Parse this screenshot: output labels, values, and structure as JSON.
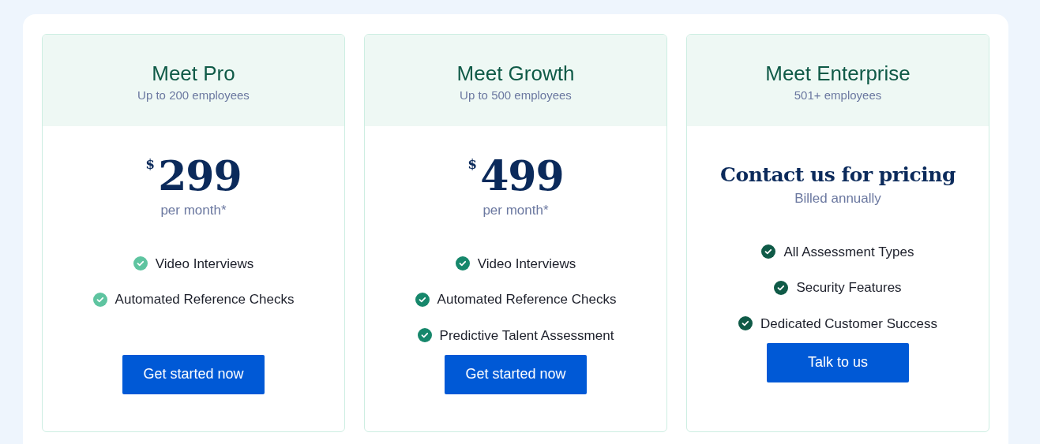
{
  "plans": [
    {
      "name": "Meet Pro",
      "audience": "Up to 200 employees",
      "pricing": {
        "kind": "price",
        "currency": "$",
        "amount": "299",
        "period": "per month*"
      },
      "color": "#5ec4a0",
      "features": [
        "Video Interviews",
        "Automated Reference Checks"
      ],
      "button": "Get started now"
    },
    {
      "name": "Meet Growth",
      "audience": "Up to 500 employees",
      "pricing": {
        "kind": "price",
        "currency": "$",
        "amount": "499",
        "period": "per month*"
      },
      "color": "#16876b",
      "features": [
        "Video Interviews",
        "Automated Reference Checks",
        "Predictive Talent Assessment"
      ],
      "button": "Get started now"
    },
    {
      "name": "Meet Enterprise",
      "audience": "501+ employees",
      "pricing": {
        "kind": "contact",
        "heading": "Contact us for pricing",
        "note": "Billed annually"
      },
      "color": "#0f5a47",
      "features": [
        "All Assessment Types",
        "Security Features",
        "Dedicated Customer Success"
      ],
      "button": "Talk to us"
    }
  ]
}
